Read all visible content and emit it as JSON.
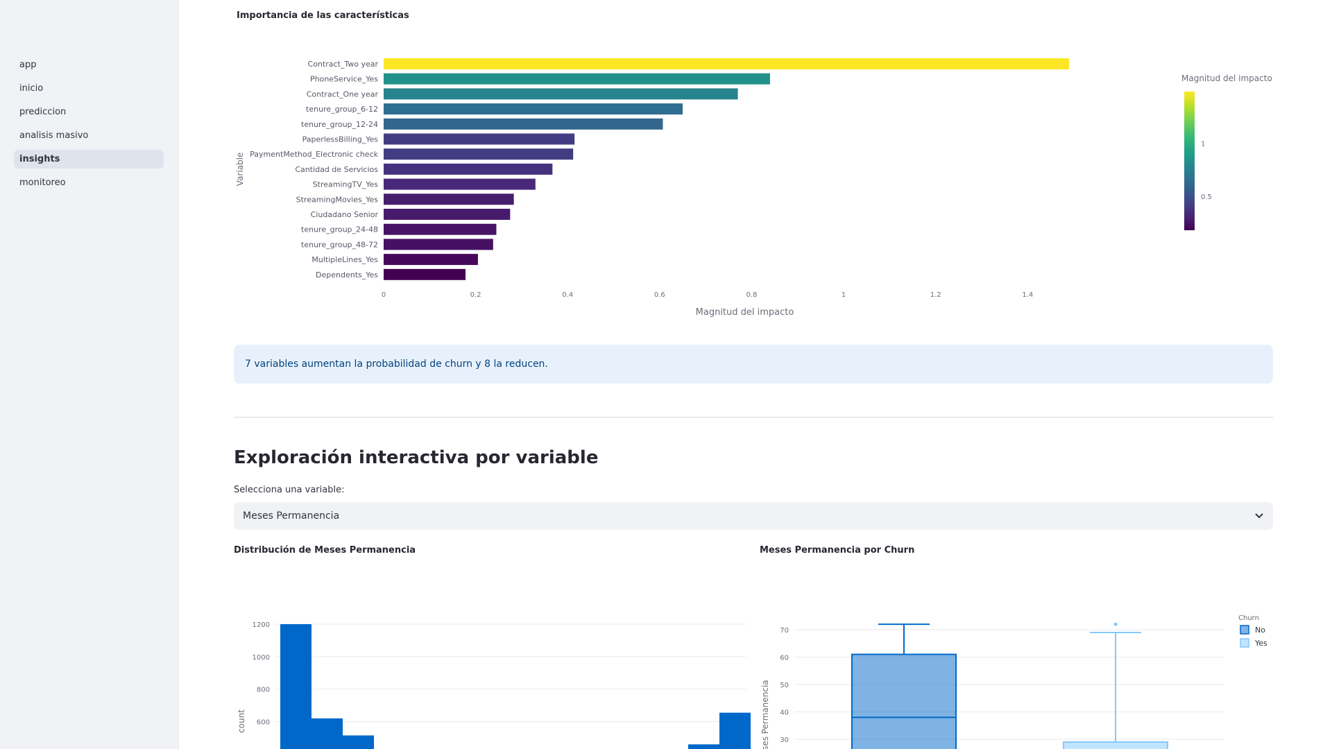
{
  "sidebar": {
    "items": [
      {
        "label": "app",
        "active": false
      },
      {
        "label": "inicio",
        "active": false
      },
      {
        "label": "prediccion",
        "active": false
      },
      {
        "label": "analisis masivo",
        "active": false
      },
      {
        "label": "insights",
        "active": true
      },
      {
        "label": "monitoreo",
        "active": false
      }
    ]
  },
  "importance": {
    "title": "Importancia de las características",
    "colorbar_title": "Magnitud del impacto",
    "colorbar_ticks": [
      "1",
      "0.5"
    ]
  },
  "info_message": "7 variables aumentan la probabilidad de churn y 8 la reducen.",
  "exploration": {
    "title": "Exploración interactiva por variable",
    "select_label": "Selecciona una variable:",
    "select_value": "Meses Permanencia",
    "hist_title": "Distribución de Meses Permanencia",
    "box_title": "Meses Permanencia por Churn"
  },
  "chart_data": [
    {
      "type": "bar",
      "orientation": "horizontal",
      "categories": [
        "Contract_Two year",
        "PhoneService_Yes",
        "Contract_One year",
        "tenure_group_6-12",
        "tenure_group_12-24",
        "PaperlessBilling_Yes",
        "PaymentMethod_Electronic check",
        "Cantidad de Servicios",
        "StreamingTV_Yes",
        "StreamingMovies_Yes",
        "Ciudadano Senior",
        "tenure_group_24-48",
        "tenure_group_48-72",
        "MultipleLines_Yes",
        "Dependents_Yes"
      ],
      "values": [
        1.49,
        0.84,
        0.77,
        0.65,
        0.607,
        0.415,
        0.412,
        0.367,
        0.33,
        0.283,
        0.275,
        0.245,
        0.238,
        0.205,
        0.178
      ],
      "xlabel": "Magnitud del impacto",
      "ylabel": "Variable",
      "xticks": [
        0,
        0.2,
        0.4,
        0.6,
        0.8,
        1,
        1.2,
        1.4
      ],
      "xlim": [
        0,
        1.57
      ],
      "colorscale": "viridis"
    },
    {
      "type": "bar",
      "title": "Distribución de Meses Permanencia",
      "x_bin_visible": [
        "bin 1",
        "bin 2",
        "bin 3",
        "last-1",
        "last"
      ],
      "values": [
        1200,
        620,
        515,
        460,
        655
      ],
      "ylabel": "count",
      "yticks": [
        600,
        800,
        1000,
        1200
      ],
      "color": "#0068c9"
    },
    {
      "type": "box",
      "title": "Meses Permanencia por Churn",
      "ylabel": "Meses Permanencia",
      "yticks": [
        30,
        40,
        50,
        60,
        70
      ],
      "legend_title": "Churn",
      "series": [
        {
          "name": "No",
          "max": 72,
          "q3": 61,
          "median": 38,
          "color": "#0068c9"
        },
        {
          "name": "Yes",
          "max": 69,
          "q3": 29,
          "outlier": 72,
          "color": "#83c9ff"
        }
      ]
    }
  ]
}
